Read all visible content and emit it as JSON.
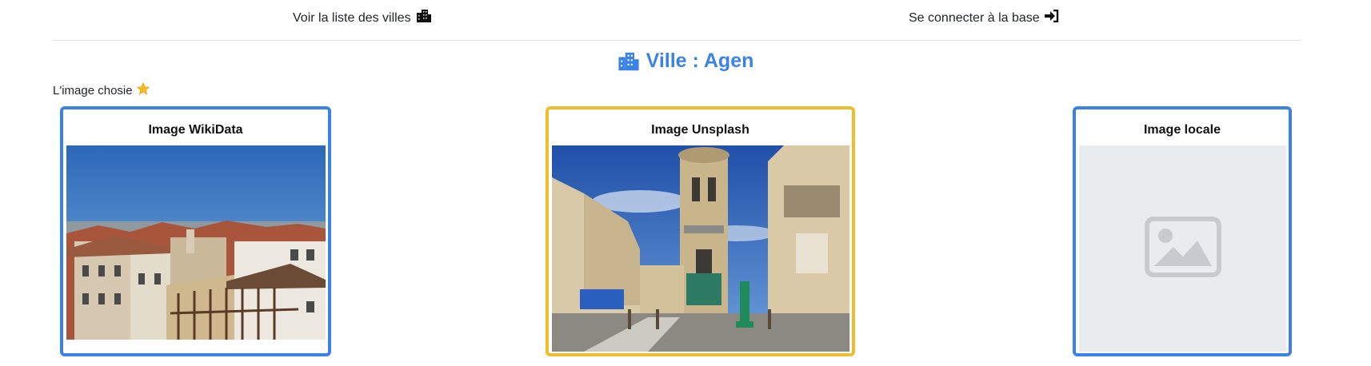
{
  "nav": {
    "cities_link": "Voir la liste des villes",
    "cities_icon": "city-icon",
    "login_link": "Se connecter à la base",
    "login_icon": "sign-in-icon"
  },
  "page": {
    "title": "Ville : Agen",
    "title_icon": "city-icon",
    "chosen_label": "L'image chosie",
    "chosen_icon": "star-icon"
  },
  "cards": [
    {
      "title": "Image WikiData",
      "selected": false,
      "image": "photo-agen-rooftops"
    },
    {
      "title": "Image Unsplash",
      "selected": true,
      "image": "photo-agen-street-tower"
    },
    {
      "title": "Image locale",
      "selected": false,
      "image": "image-placeholder-icon"
    }
  ],
  "colors": {
    "accent": "#3b82e6",
    "selected_border": "#f2bd2c",
    "placeholder_bg": "#e9ecef",
    "star": "#f6b81c"
  }
}
